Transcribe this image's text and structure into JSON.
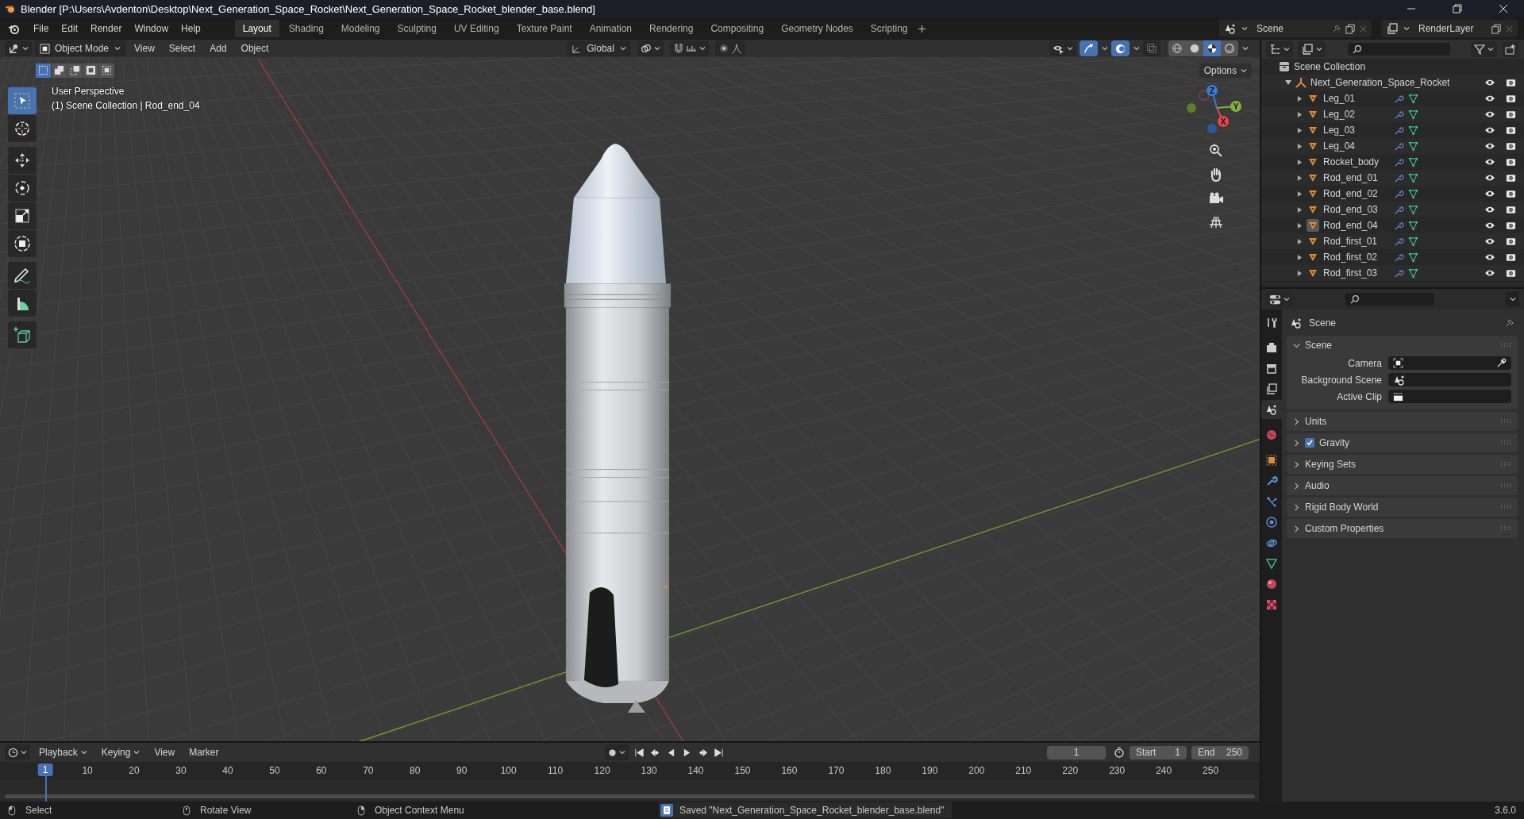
{
  "window": {
    "title": "Blender [P:\\Users\\Avdenton\\Desktop\\Next_Generation_Space_Rocket\\Next_Generation_Space_Rocket_blender_base.blend]"
  },
  "menu": [
    "File",
    "Edit",
    "Render",
    "Window",
    "Help"
  ],
  "workspaces": [
    {
      "label": "Layout",
      "selected": true
    },
    {
      "label": "Shading",
      "selected": false
    },
    {
      "label": "Modeling",
      "selected": false
    },
    {
      "label": "Sculpting",
      "selected": false
    },
    {
      "label": "UV Editing",
      "selected": false
    },
    {
      "label": "Texture Paint",
      "selected": false
    },
    {
      "label": "Animation",
      "selected": false
    },
    {
      "label": "Rendering",
      "selected": false
    },
    {
      "label": "Compositing",
      "selected": false
    },
    {
      "label": "Geometry Nodes",
      "selected": false
    },
    {
      "label": "Scripting",
      "selected": false
    }
  ],
  "scene_selector": {
    "value": "Scene"
  },
  "view_layer_selector": {
    "value": "RenderLayer"
  },
  "viewport": {
    "mode": "Object Mode",
    "menus": [
      "View",
      "Select",
      "Add",
      "Object"
    ],
    "orientation": "Global",
    "options": "Options",
    "shading_modes": [
      {
        "kind": "wireframe",
        "selected": false
      },
      {
        "kind": "solid",
        "selected": false
      },
      {
        "kind": "material",
        "selected": true
      },
      {
        "kind": "rendered",
        "selected": false
      }
    ],
    "select_modes": [
      {
        "selected": true
      },
      {
        "selected": false
      },
      {
        "selected": false
      },
      {
        "selected": false
      },
      {
        "selected": false
      }
    ],
    "tools": [
      {
        "kind": "select",
        "selected": true
      },
      {
        "kind": "cursor",
        "selected": false
      },
      {
        "kind": "move",
        "selected": false
      },
      {
        "kind": "rotate",
        "selected": false
      },
      {
        "kind": "scale",
        "selected": false
      },
      {
        "kind": "transform",
        "selected": false
      },
      {
        "kind": "annotate",
        "selected": false
      },
      {
        "kind": "measure",
        "selected": false
      },
      {
        "kind": "add_cube",
        "selected": false
      }
    ],
    "info": [
      "User Perspective",
      "(1) Scene Collection | Rod_end_04"
    ],
    "gizmo_axes": [
      "Z",
      "Y",
      "X"
    ]
  },
  "outliner": {
    "root": "Scene Collection",
    "collection": {
      "name": "Next_Generation_Space_Rocket",
      "expanded": true,
      "children": [
        {
          "name": "Leg_01",
          "expanded": false,
          "active": false
        },
        {
          "name": "Leg_02",
          "expanded": false,
          "active": false
        },
        {
          "name": "Leg_03",
          "expanded": false,
          "active": false
        },
        {
          "name": "Leg_04",
          "expanded": false,
          "active": false
        },
        {
          "name": "Rocket_body",
          "expanded": false,
          "active": false
        },
        {
          "name": "Rod_end_01",
          "expanded": false,
          "active": false
        },
        {
          "name": "Rod_end_02",
          "expanded": false,
          "active": false
        },
        {
          "name": "Rod_end_03",
          "expanded": false,
          "active": false
        },
        {
          "name": "Rod_end_04",
          "expanded": false,
          "active": true
        },
        {
          "name": "Rod_first_01",
          "expanded": false,
          "active": false
        },
        {
          "name": "Rod_first_02",
          "expanded": false,
          "active": false
        },
        {
          "name": "Rod_first_03",
          "expanded": false,
          "active": false
        }
      ]
    }
  },
  "properties": {
    "tabs": [
      {
        "kind": "tool",
        "selected": false
      },
      {
        "kind": "render",
        "selected": false
      },
      {
        "kind": "output",
        "selected": false
      },
      {
        "kind": "view_layer",
        "selected": false
      },
      {
        "kind": "scene",
        "selected": true
      },
      {
        "kind": "world",
        "selected": false
      },
      {
        "kind": "object",
        "selected": false
      },
      {
        "kind": "modifier",
        "selected": false
      },
      {
        "kind": "particles",
        "selected": false
      },
      {
        "kind": "physics",
        "selected": false
      },
      {
        "kind": "constraint",
        "selected": false
      },
      {
        "kind": "data",
        "selected": false
      },
      {
        "kind": "material",
        "selected": false
      },
      {
        "kind": "texture",
        "selected": false
      }
    ],
    "context": "Scene",
    "panels": [
      {
        "title": "Scene",
        "kind": "plain",
        "expanded": true,
        "fields": [
          {
            "label": "Camera",
            "kind": "camera"
          },
          {
            "label": "Background Scene",
            "kind": "scene"
          },
          {
            "label": "Active Clip",
            "kind": "clip"
          }
        ]
      },
      {
        "title": "Units",
        "kind": "plain",
        "expanded": false
      },
      {
        "title": "Gravity",
        "kind": "checkbox",
        "checked": true,
        "expanded": false
      },
      {
        "title": "Keying Sets",
        "kind": "plain",
        "expanded": false
      },
      {
        "title": "Audio",
        "kind": "plain",
        "expanded": false
      },
      {
        "title": "Rigid Body World",
        "kind": "plain",
        "expanded": false
      },
      {
        "title": "Custom Properties",
        "kind": "plain",
        "expanded": false
      }
    ]
  },
  "timeline": {
    "menus": [
      "Playback",
      "Keying",
      "View",
      "Marker"
    ],
    "current_frame": "1",
    "start_label": "Start",
    "start": "1",
    "end_label": "End",
    "end": "250",
    "playhead": "1",
    "ruler": [
      "10",
      "20",
      "30",
      "40",
      "50",
      "60",
      "70",
      "80",
      "90",
      "100",
      "110",
      "120",
      "130",
      "140",
      "150",
      "160",
      "170",
      "180",
      "190",
      "200",
      "210",
      "220",
      "230",
      "240",
      "250"
    ]
  },
  "status_bar": {
    "hints": [
      "Select",
      "Rotate View",
      "Object Context Menu"
    ],
    "message": "Saved \"Next_Generation_Space_Rocket_blender_base.blend\"",
    "version": "3.6.0"
  }
}
